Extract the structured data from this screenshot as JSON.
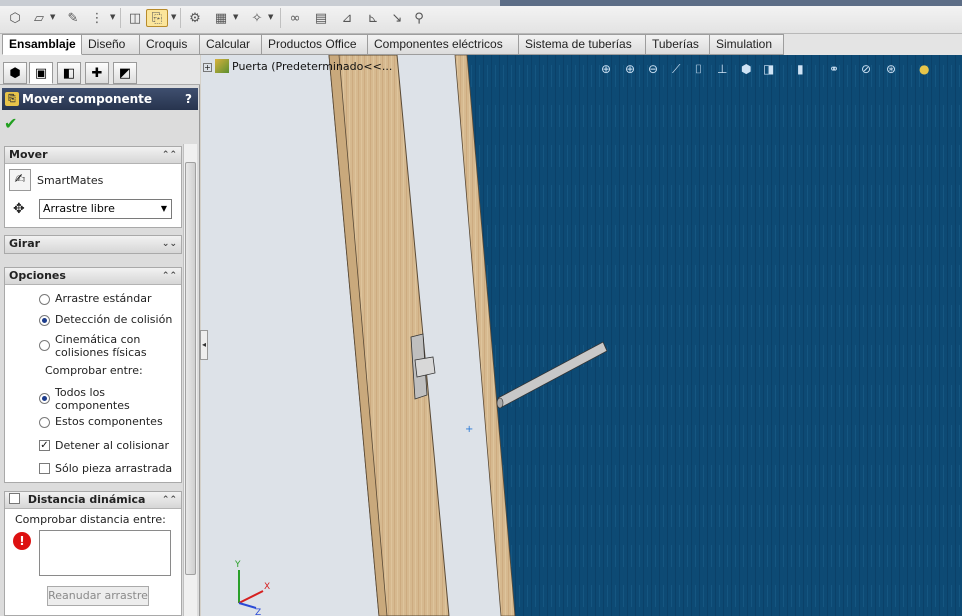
{
  "toolbar": {
    "icons": [
      "new-part-icon",
      "open-icon",
      "paperclip-icon",
      "configure-icon",
      "insert-component-icon",
      "move-component-icon",
      "mate-icon",
      "linear-pattern-icon",
      "smart-fastener-icon",
      "explode-icon",
      "bill-of-materials-icon",
      "interference-icon",
      "simulation-icon",
      "instant3d-icon"
    ]
  },
  "tabs": [
    "Ensamblaje",
    "Diseño",
    "Croquis",
    "Calcular",
    "Productos Office",
    "Componentes eléctricos",
    "Sistema de tuberías",
    "Tuberías",
    "Simulation"
  ],
  "property_manager": {
    "title": "Mover componente",
    "help": "?",
    "ok": "✔",
    "mover": {
      "header": "Mover",
      "smartmates": "SmartMates",
      "drag_mode": "Arrastre libre"
    },
    "girar": {
      "header": "Girar"
    },
    "opciones": {
      "header": "Opciones",
      "opt_standard": "Arrastre estándar",
      "opt_collision": "Detección de colisión",
      "opt_physics_1": "Cinemática con",
      "opt_physics_2": "colisiones físicas",
      "check_between": "Comprobar entre:",
      "opt_all_1": "Todos los",
      "opt_all_2": "componentes",
      "opt_these": "Estos componentes",
      "stop_on_collision": "Detener al colisionar",
      "only_dragged": "Sólo pieza arrastrada"
    },
    "distancia": {
      "header": "Distancia dinámica",
      "check_label": "Comprobar distancia entre:",
      "resume_button": "Reanudar arrastre"
    }
  },
  "tree": {
    "root": "Puerta  (Predeterminado<<..."
  },
  "colors": {
    "viewport_bg": "#0d4a74",
    "wood": "#d4b48a",
    "title_bar": "#2f3d5a"
  }
}
